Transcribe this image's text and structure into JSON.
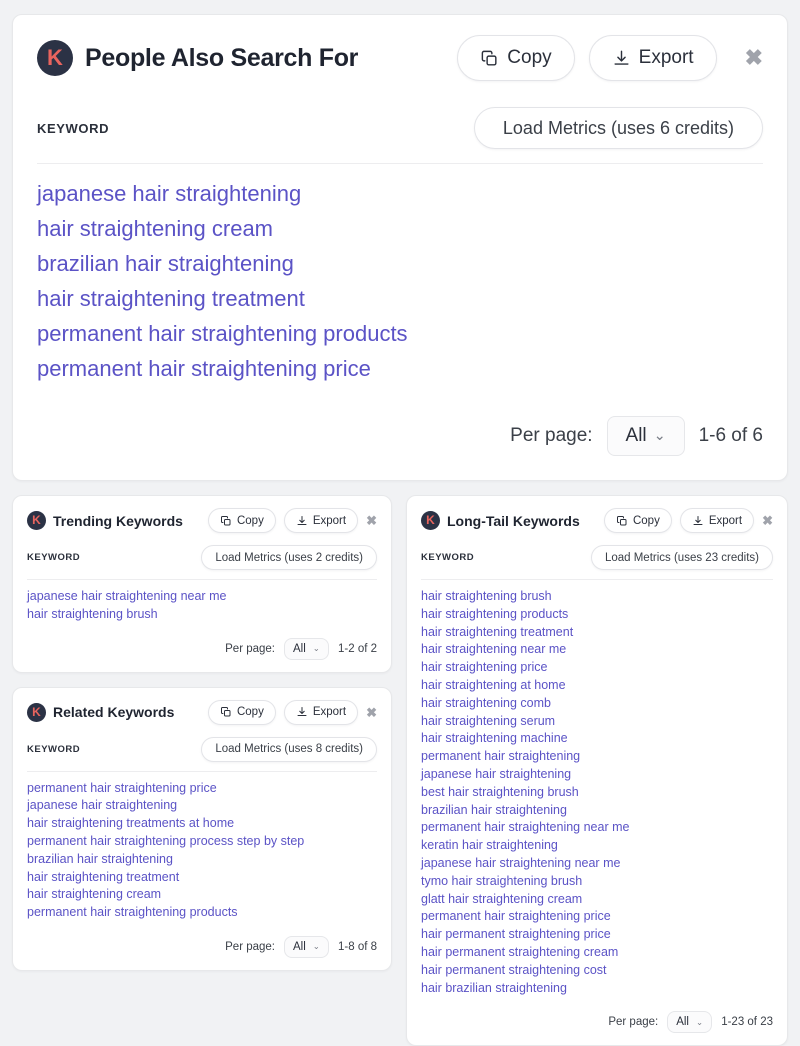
{
  "brand": {
    "logo_letter": "K",
    "logo_bg": "#2b3245",
    "logo_fg": "#e8645e"
  },
  "colors": {
    "keyword_link": "#5b53c6",
    "page_bg": "#f1f2f4",
    "card_bg": "#ffffff"
  },
  "common": {
    "copy_label": "Copy",
    "export_label": "Export",
    "close_glyph": "✖",
    "keyword_column": "KEYWORD",
    "per_page_label": "Per page:",
    "per_page_value": "All",
    "caret": "⌄"
  },
  "hero": {
    "title": "People Also Search For",
    "copy_label": "Copy",
    "export_label": "Export",
    "keyword_column": "KEYWORD",
    "load_metrics_label": "Load Metrics (uses 6 credits)",
    "keywords": [
      "japanese hair straightening",
      "hair straightening cream",
      "brazilian hair straightening",
      "hair straightening treatment",
      "permanent hair straightening products",
      "permanent hair straightening price"
    ],
    "per_page_label": "Per page:",
    "per_page_value": "All",
    "range_label": "1-6 of 6"
  },
  "trending": {
    "title": "Trending Keywords",
    "copy_label": "Copy",
    "export_label": "Export",
    "keyword_column": "KEYWORD",
    "load_metrics_label": "Load Metrics (uses 2 credits)",
    "keywords": [
      "japanese hair straightening near me",
      "hair straightening brush"
    ],
    "per_page_label": "Per page:",
    "per_page_value": "All",
    "range_label": "1-2 of 2"
  },
  "related": {
    "title": "Related Keywords",
    "copy_label": "Copy",
    "export_label": "Export",
    "keyword_column": "KEYWORD",
    "load_metrics_label": "Load Metrics (uses 8 credits)",
    "keywords": [
      "permanent hair straightening price",
      "japanese hair straightening",
      "hair straightening treatments at home",
      "permanent hair straightening process step by step",
      "brazilian hair straightening",
      "hair straightening treatment",
      "hair straightening cream",
      "permanent hair straightening products"
    ],
    "per_page_label": "Per page:",
    "per_page_value": "All",
    "range_label": "1-8 of 8"
  },
  "longtail": {
    "title": "Long-Tail Keywords",
    "copy_label": "Copy",
    "export_label": "Export",
    "keyword_column": "KEYWORD",
    "load_metrics_label": "Load Metrics (uses 23 credits)",
    "keywords": [
      "hair straightening brush",
      "hair straightening products",
      "hair straightening treatment",
      "hair straightening near me",
      "hair straightening price",
      "hair straightening at home",
      "hair straightening comb",
      "hair straightening serum",
      "hair straightening machine",
      "permanent hair straightening",
      "japanese hair straightening",
      "best hair straightening brush",
      "brazilian hair straightening",
      "permanent hair straightening near me",
      "keratin hair straightening",
      "japanese hair straightening near me",
      "tymo hair straightening brush",
      "glatt hair straightening cream",
      "permanent hair straightening price",
      "hair permanent straightening price",
      "hair permanent straightening cream",
      "hair permanent straightening cost",
      "hair brazilian straightening"
    ],
    "per_page_label": "Per page:",
    "per_page_value": "All",
    "range_label": "1-23 of 23"
  }
}
